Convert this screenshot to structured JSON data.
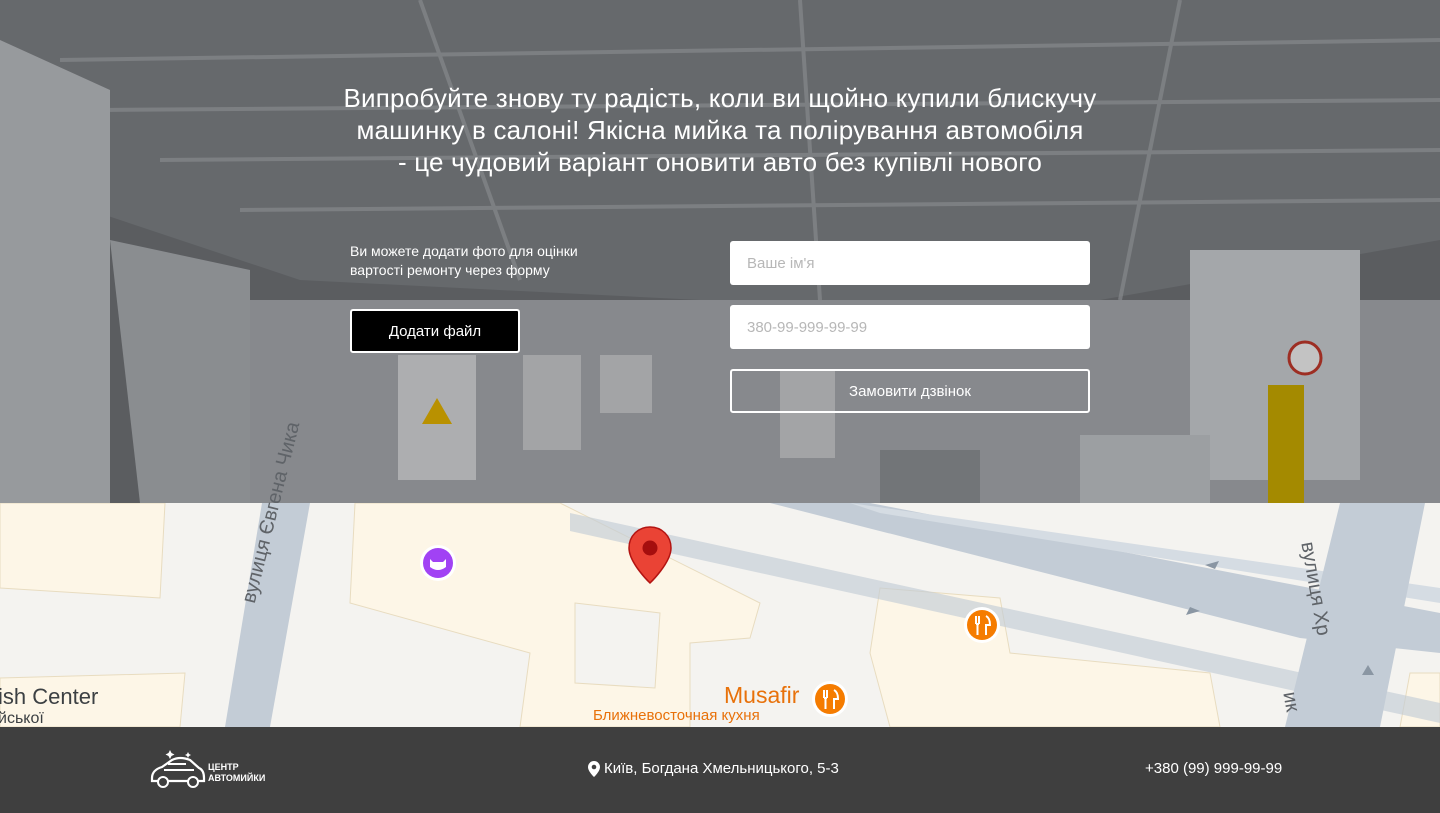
{
  "hero": {
    "headline_lines": [
      "Випробуйте знову ту радість, коли ви щойно купили блискучу",
      "машинку в салоні! Якісна мийка та полірування автомобіля",
      "- це чудовий варіант оновити авто без купівлі нового"
    ],
    "upload_text_lines": [
      "Ви можете додати фото для оцінки",
      "вартості ремонту через форму"
    ],
    "add_file_label": "Додати файл",
    "name_placeholder": "Ваше ім'я",
    "phone_placeholder": "380-99-999-99-99",
    "order_call_label": "Замовити дзвінок"
  },
  "map": {
    "street_left": "вулиця Євгена Чика",
    "street_right": "вулиця Хр",
    "street_right_tail": "ик",
    "place_left_1": "ish Center",
    "place_left_2": "йської",
    "restaurant_name": "Musafir",
    "restaurant_type": "Ближневосточная кухня",
    "colors": {
      "pin": "#ea4335",
      "food": "#f57c00",
      "pet": "#a142f4",
      "road": "#c3ccd6",
      "building": "#fdf6e7"
    }
  },
  "footer": {
    "logo_text_1": "ЦЕНТР",
    "logo_text_2": "АВТОМИЙКИ",
    "address": "Київ, Богдана Хмельницького, 5-3",
    "phone": "+380 (99) 999-99-99"
  }
}
